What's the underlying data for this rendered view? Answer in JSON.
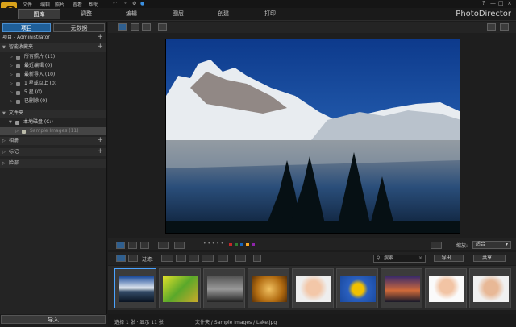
{
  "menu": {
    "items": [
      "文件",
      "编辑",
      "照片",
      "查看",
      "帮助"
    ]
  },
  "help": [
    "?",
    "—",
    "□",
    "×"
  ],
  "tabs": [
    "图库",
    "调整",
    "编辑",
    "图层",
    "创建",
    "打印"
  ],
  "brand": "PhotoDirector",
  "left_panel": {
    "tabs": [
      "项目",
      "元数据"
    ],
    "project_label": "项目 - Administrator",
    "smart": {
      "label": "智能收藏夹",
      "items": [
        "所有照片 (11)",
        "最近编辑 (0)",
        "最新导入 (10)",
        "1 星或以上 (0)",
        "5 星 (0)",
        "已删除 (0)"
      ]
    },
    "folders": {
      "label": "文件夹",
      "drive": "本地磁盘 (C:)",
      "folder": "Sample Images (11)"
    },
    "albums": "相册",
    "tags": "标记",
    "faces": "脸部",
    "import": "导入"
  },
  "filter": {
    "label": "过滤:",
    "search_placeholder": "搜索",
    "export": "导出...",
    "share": "共享...",
    "zoom_label": "缩放:",
    "zoom_value": "适合"
  },
  "colors": {
    "accent": "#1f5f99",
    "labels": [
      "#c62828",
      "#2e7d32",
      "#1565c0",
      "#f9a825",
      "#8e24aa"
    ]
  },
  "thumbnails": [
    "湖泊",
    "绿叶",
    "风景",
    "螺旋",
    "人像",
    "向日葵",
    "日落",
    "女孩",
    "女性"
  ],
  "status": {
    "selection": "选择 1 张 · 显示 11 张",
    "path": "文件夹 / Sample Images / Lake.jpg"
  }
}
